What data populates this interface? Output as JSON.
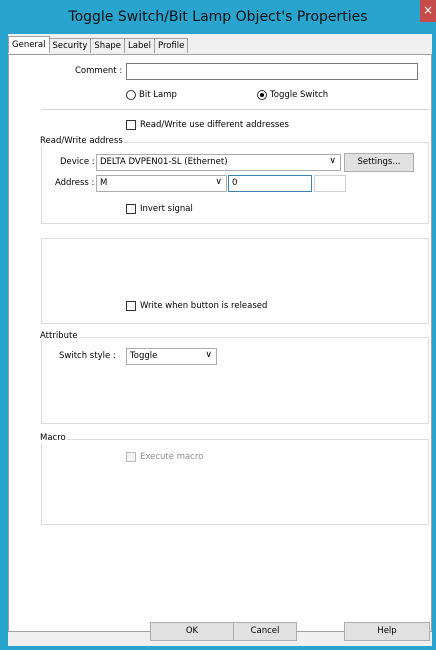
{
  "window": {
    "title": "Toggle Switch/Bit Lamp Object's Properties",
    "close_glyph": "×"
  },
  "tabs": [
    {
      "label": "General"
    },
    {
      "label": "Security"
    },
    {
      "label": "Shape"
    },
    {
      "label": "Label"
    },
    {
      "label": "Profile"
    }
  ],
  "general": {
    "comment_label": "Comment :",
    "comment_value": "",
    "type_bit_lamp": "Bit Lamp",
    "type_toggle_switch": "Toggle Switch",
    "selected_type": "Toggle Switch",
    "rw_different": "Read/Write use different addresses",
    "rw_group_title": "Read/Write address",
    "device_label": "Device :",
    "device_value": "DELTA DVPEN01-SL (Ethernet)",
    "settings_button": "Settings...",
    "address_label": "Address :",
    "address_type": "M",
    "address_value": "0",
    "invert_signal": "Invert signal",
    "write_on_release": "Write when button is released",
    "attribute_group_title": "Attribute",
    "switch_style_label": "Switch style :",
    "switch_style_value": "Toggle",
    "macro_group_title": "Macro",
    "execute_macro": "Execute macro",
    "chevron": "∨"
  },
  "footer": {
    "ok": "OK",
    "cancel": "Cancel",
    "help": "Help"
  }
}
